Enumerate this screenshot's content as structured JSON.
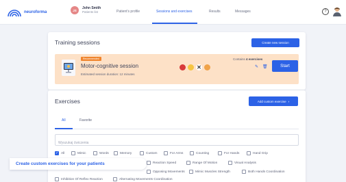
{
  "brand": {
    "name": "neuroforma",
    "color": "#2c62e6"
  },
  "patient": {
    "initials": "JS",
    "name": "John Smith",
    "subtitle": "Patients list"
  },
  "nav": {
    "items": [
      "Patient's profile",
      "Sessions and exercises",
      "Results",
      "Messages"
    ],
    "active": "Sessions and exercises"
  },
  "icons": {
    "help": "help-icon",
    "user": "user-avatar-icon"
  },
  "training": {
    "title": "Training sessions",
    "create_label": "Create new session",
    "session": {
      "tag": "Recommended",
      "name": "Motor-cognitive session",
      "duration": "Estimated session duration: 12 minutes",
      "contains_prefix": "Contains ",
      "contains_count": "4 exercises",
      "start_label": "Start",
      "exercise_icons": [
        "exercise-icon-1",
        "exercise-icon-2",
        "exercise-icon-3",
        "exercise-icon-4"
      ]
    }
  },
  "exercises": {
    "title": "Exercises",
    "add_label": "Add custom exercise",
    "tabs": [
      "All",
      "Favorite"
    ],
    "active_tab": "All",
    "search_placeholder": "Wyszukaj ćwiczenia",
    "filters_row1": [
      {
        "label": "All",
        "checked": true
      },
      {
        "label": "Mimic",
        "checked": false
      },
      {
        "label": "Words",
        "checked": false
      },
      {
        "label": "Memory",
        "checked": false
      },
      {
        "label": "Custom",
        "checked": false
      },
      {
        "label": "For Arms",
        "checked": false
      },
      {
        "label": "Counting",
        "checked": false
      },
      {
        "label": "For Hands",
        "checked": false
      },
      {
        "label": "Hand Grip",
        "checked": false
      }
    ],
    "filters_row2": [
      {
        "label": "Reaction Speed",
        "checked": false
      },
      {
        "label": "Range Of Motion",
        "checked": false
      },
      {
        "label": "Visual Analysis",
        "checked": false
      }
    ],
    "filters_row3": [
      {
        "label": "Opposing Movements",
        "checked": false
      },
      {
        "label": "Mimic Muscles Strength",
        "checked": false
      },
      {
        "label": "Both Hands Coordination",
        "checked": false
      }
    ],
    "filters_row4": [
      {
        "label": "Inhibition Of Reflex Reaction",
        "checked": false
      },
      {
        "label": "Alternating Movements Coordination",
        "checked": false
      }
    ]
  },
  "banner": {
    "text": "Create custom exercises for your patients"
  },
  "colors": {
    "accent": "#2c62e6",
    "session_bg": "#fde1c7",
    "tag": "#f0842c",
    "page_bg": "#f1f3f8"
  }
}
